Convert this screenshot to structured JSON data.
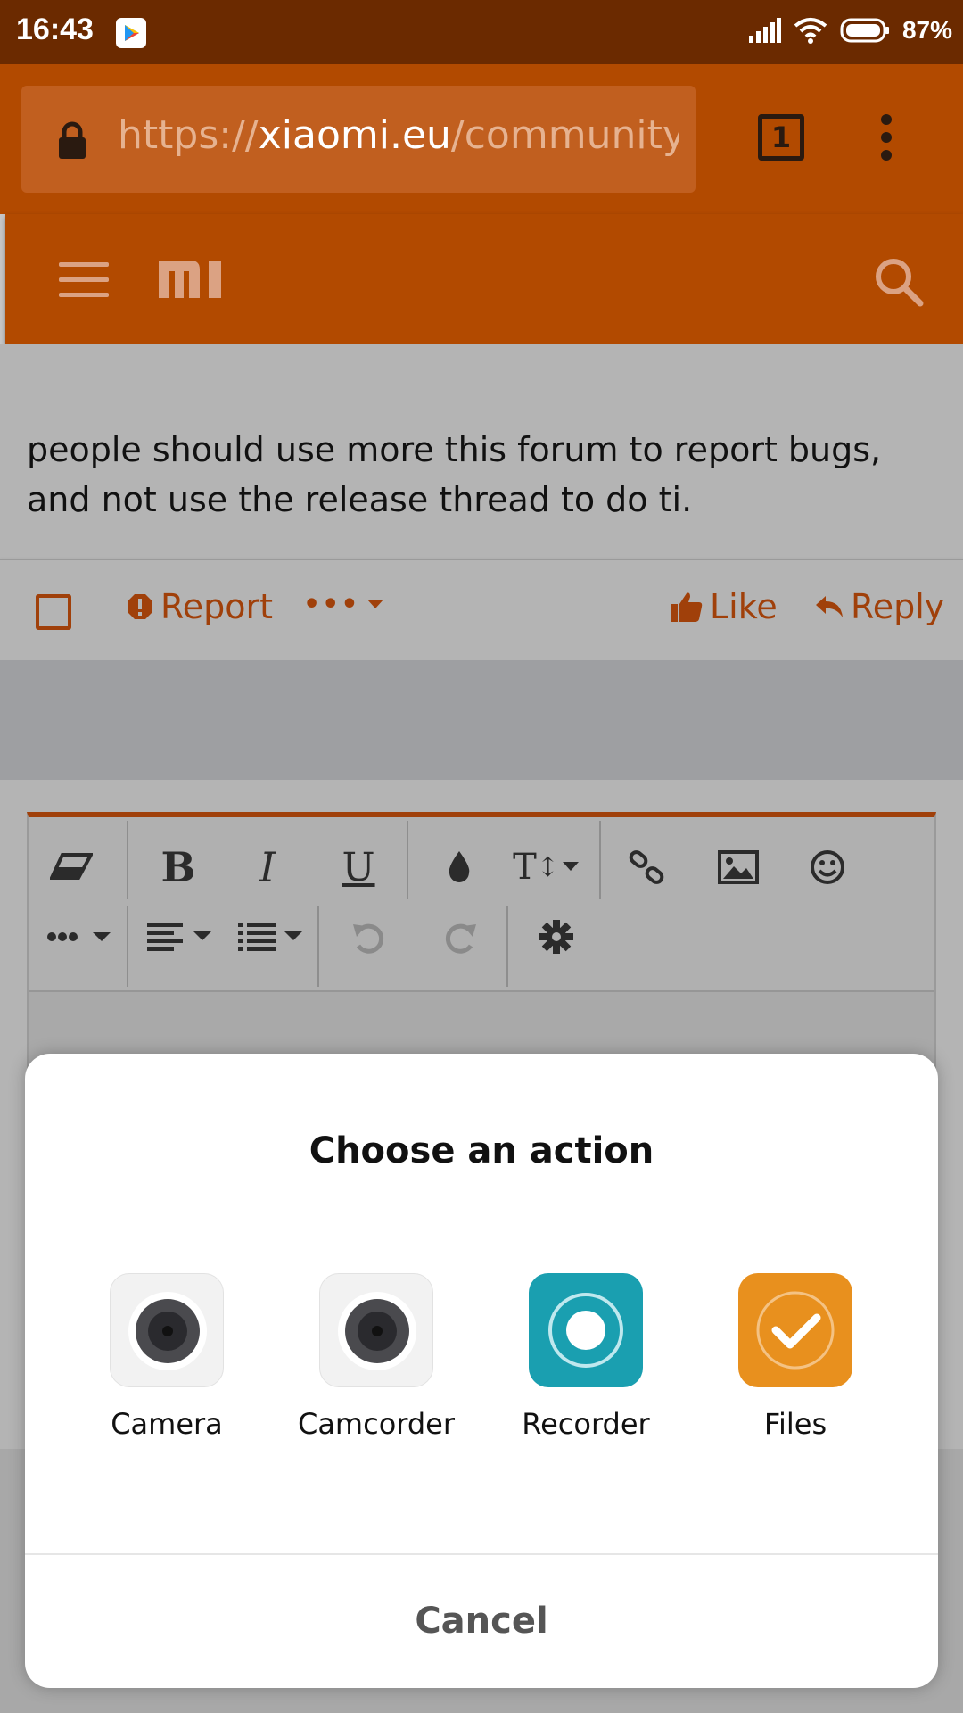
{
  "status_bar": {
    "time": "16:43",
    "battery": "87%",
    "icons": [
      "play-store-notification-icon",
      "signal-icon",
      "wifi-icon",
      "battery-icon"
    ]
  },
  "browser": {
    "url_prefix": "https://",
    "url_domain": "xiaomi.eu",
    "url_path": "/community/th",
    "tab_count": "1"
  },
  "post": {
    "text": "people should use more this forum to report bugs, and not use the release thread to do ti.",
    "actions": {
      "report": "Report",
      "more": "•••",
      "like": "Like",
      "reply": "Reply"
    }
  },
  "dialog": {
    "title": "Choose an action",
    "apps": [
      {
        "label": "Camera",
        "icon": "camera-icon"
      },
      {
        "label": "Camcorder",
        "icon": "camcorder-icon"
      },
      {
        "label": "Recorder",
        "icon": "recorder-icon"
      },
      {
        "label": "Files",
        "icon": "files-icon"
      }
    ],
    "cancel": "Cancel"
  },
  "colors": {
    "status_bar": "#6b2a00",
    "brand": "#b24a00",
    "accent_text": "#a0400a",
    "recorder": "#1a9fb0",
    "files": "#e8901e"
  }
}
